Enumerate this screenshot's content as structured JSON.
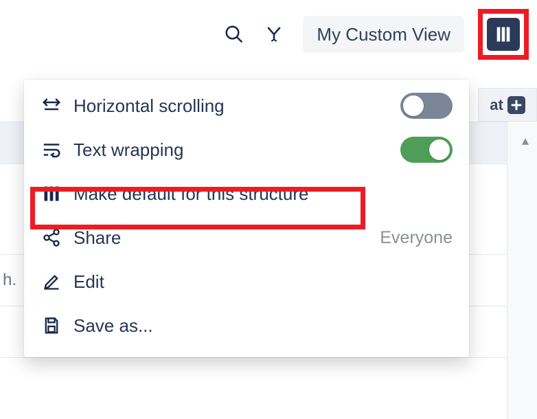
{
  "toolbar": {
    "view_label": "My Custom View"
  },
  "right_header": {
    "text": "at"
  },
  "bg_rows": {
    "row1_fragment": "h."
  },
  "menu": {
    "horizontal_scrolling": {
      "label": "Horizontal scrolling",
      "on": false
    },
    "text_wrapping": {
      "label": "Text wrapping",
      "on": true
    },
    "make_default": {
      "label": "Make default for this structure"
    },
    "share": {
      "label": "Share",
      "scope": "Everyone"
    },
    "edit": {
      "label": "Edit"
    },
    "save_as": {
      "label": "Save as..."
    }
  }
}
